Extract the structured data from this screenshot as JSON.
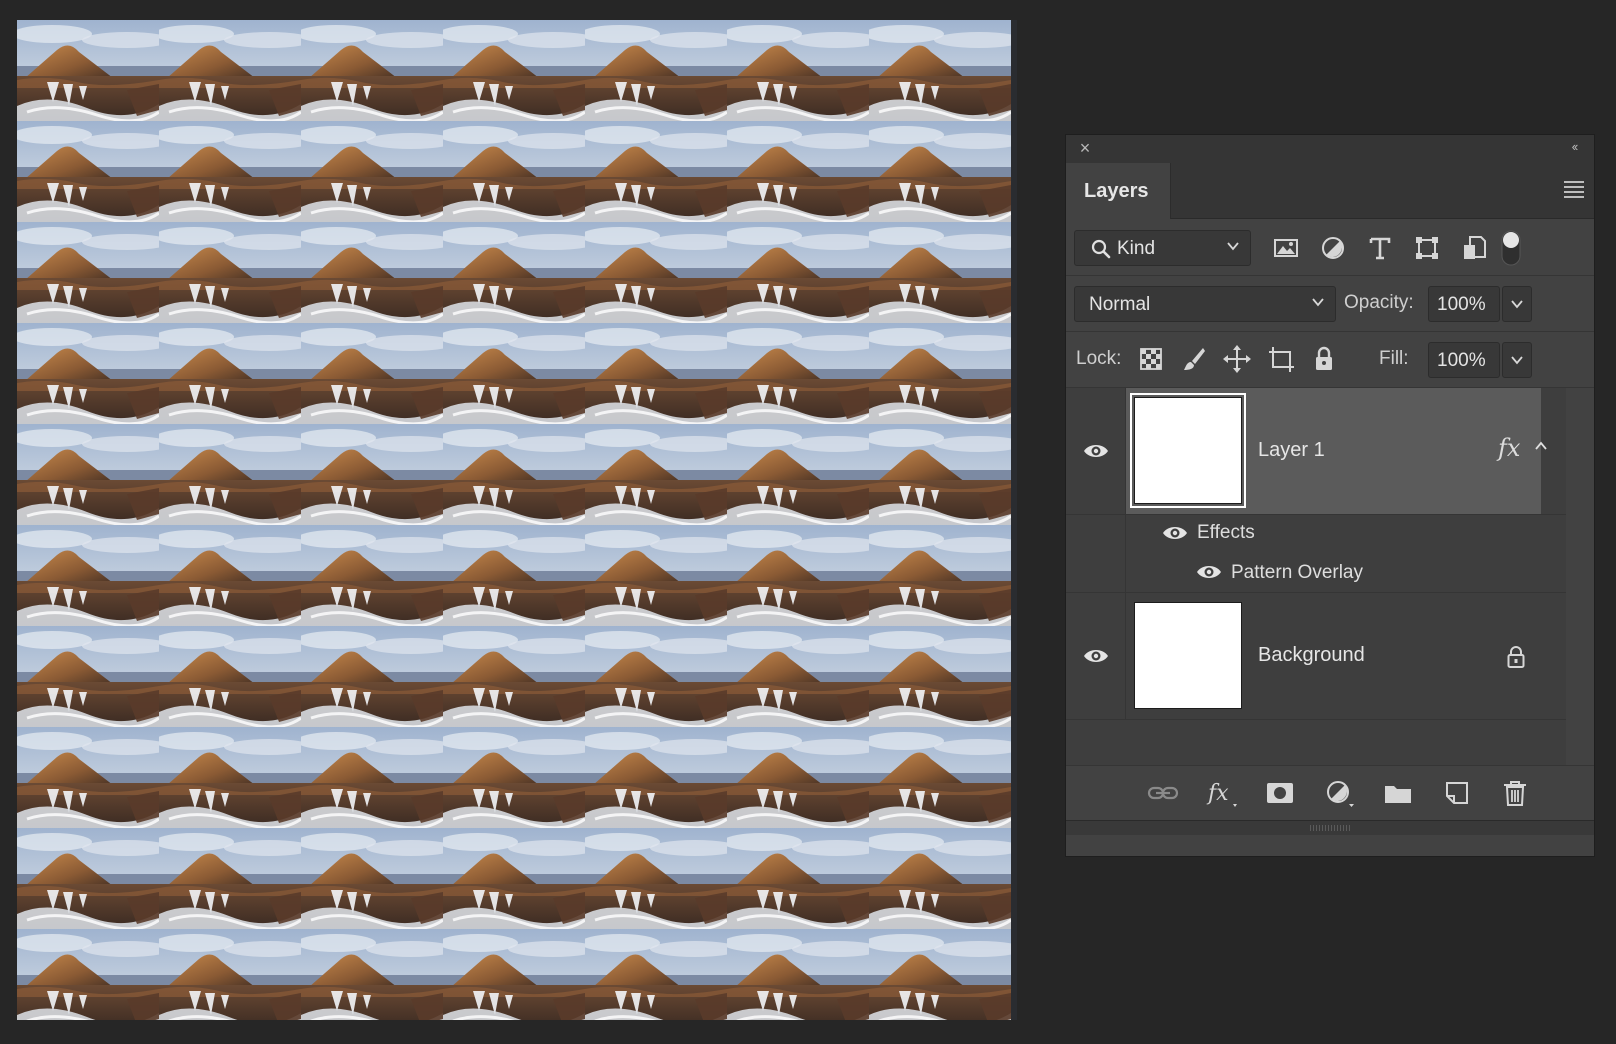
{
  "canvas": {
    "tile_rows": 10,
    "tile_cols": 7
  },
  "panel": {
    "tab_label": "Layers",
    "filter": {
      "kind_label": "Kind",
      "filter_icons": [
        "image-filter-icon",
        "adjustment-filter-icon",
        "type-filter-icon",
        "shape-filter-icon",
        "smart-object-filter-icon",
        "filter-toggle-icon"
      ]
    },
    "blend": {
      "mode": "Normal",
      "opacity_label": "Opacity:",
      "opacity_value": "100%"
    },
    "lock": {
      "label": "Lock:",
      "fill_label": "Fill:",
      "fill_value": "100%",
      "lock_icons": [
        "lock-transparent-pixels-icon",
        "lock-image-pixels-icon",
        "lock-position-icon",
        "lock-artboard-icon",
        "lock-all-icon"
      ]
    },
    "layers": [
      {
        "name": "Layer 1",
        "fx": "fx",
        "selected": true
      },
      {
        "name": "Background",
        "locked": true
      }
    ],
    "effects": {
      "header": "Effects",
      "items": [
        "Pattern Overlay"
      ]
    },
    "footer_icons": [
      "link-layers-icon",
      "add-layer-style-icon",
      "add-mask-icon",
      "new-adjustment-layer-icon",
      "new-group-icon",
      "new-layer-icon",
      "delete-layer-icon"
    ],
    "colors": {
      "panel_bg": "#424242",
      "selected_row": "#5b5b5b",
      "canvas_bg": "#262626"
    }
  }
}
